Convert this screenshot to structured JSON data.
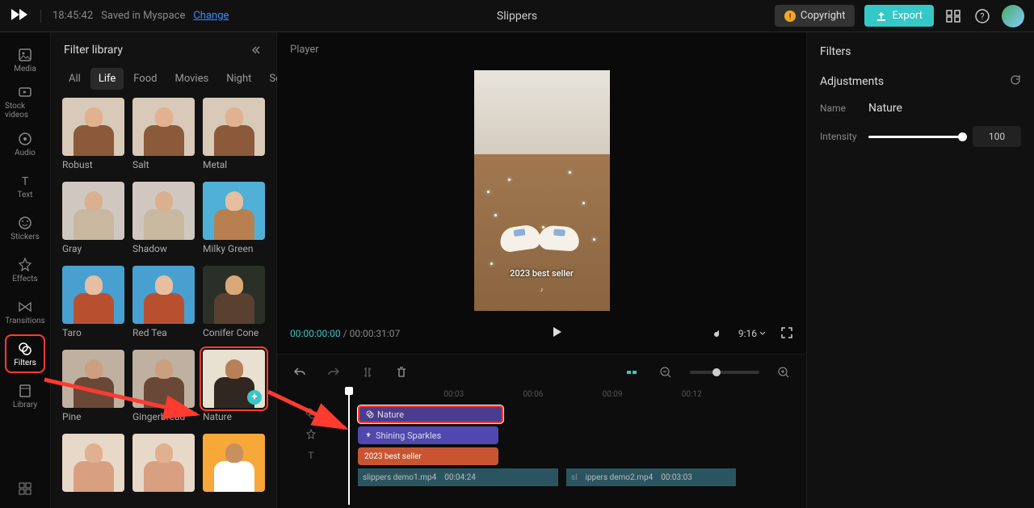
{
  "topbar": {
    "timestamp": "18:45:42",
    "saved_text": "Saved in Myspace",
    "change_link": "Change",
    "project_title": "Slippers",
    "copyright_label": "Copyright",
    "export_label": "Export"
  },
  "sidebar": {
    "items": [
      {
        "label": "Media"
      },
      {
        "label": "Stock videos"
      },
      {
        "label": "Audio"
      },
      {
        "label": "Text"
      },
      {
        "label": "Stickers"
      },
      {
        "label": "Effects"
      },
      {
        "label": "Transitions"
      },
      {
        "label": "Filters"
      },
      {
        "label": "Library"
      }
    ]
  },
  "library": {
    "title": "Filter library",
    "tabs": [
      "All",
      "Life",
      "Food",
      "Movies",
      "Night",
      "Sc"
    ],
    "active_tab": "Life",
    "filters": [
      {
        "label": "Robust",
        "bg": "#d8c9b8",
        "head": "#e2b18f",
        "body": "#8a5a3a"
      },
      {
        "label": "Salt",
        "bg": "#d8c9b8",
        "head": "#e2b18f",
        "body": "#8a5a3a"
      },
      {
        "label": "Metal",
        "bg": "#d8c9b8",
        "head": "#e2b18f",
        "body": "#8a5a3a"
      },
      {
        "label": "Gray",
        "bg": "#d0c8c0",
        "head": "#dab090",
        "body": "#c8b8a0"
      },
      {
        "label": "Shadow",
        "bg": "#d0c8c0",
        "head": "#dab090",
        "body": "#c8b8a0"
      },
      {
        "label": "Milky Green",
        "bg": "#50b0d8",
        "head": "#e6bfa0",
        "body": "#b88050"
      },
      {
        "label": "Taro",
        "bg": "#48a0d0",
        "head": "#e6bfa0",
        "body": "#b85030"
      },
      {
        "label": "Red Tea",
        "bg": "#48a0d0",
        "head": "#e6bfa0",
        "body": "#b85030"
      },
      {
        "label": "Conifer Cone",
        "bg": "#2a3028",
        "head": "#d8a878",
        "body": "#5a4030"
      },
      {
        "label": "Pine",
        "bg": "#c0b0a0",
        "head": "#caa080",
        "body": "#6a4838"
      },
      {
        "label": "Gingerbread",
        "bg": "#c0b0a0",
        "head": "#caa080",
        "body": "#6a4838"
      },
      {
        "label": "Nature",
        "bg": "#e8e0d0",
        "head": "#b88058",
        "body": "#302820"
      },
      {
        "label": "",
        "bg": "#e8d8c8",
        "head": "#e0b090",
        "body": "#d8a080"
      },
      {
        "label": "",
        "bg": "#e8d8c8",
        "head": "#e0b090",
        "body": "#d8a080"
      },
      {
        "label": "",
        "bg": "#f7a838",
        "head": "#c89060",
        "body": "#ffffff"
      }
    ],
    "selected_index": 11
  },
  "player": {
    "label": "Player",
    "current_tc": "00:00:00:00",
    "total_tc": "00:00:31:07",
    "ratio": "9:16",
    "preview_caption": "2023 best seller"
  },
  "timeline": {
    "marks": [
      "00:03",
      "00:06",
      "00:09",
      "00:12"
    ],
    "nature_clip": "Nature",
    "shining_clip": "Shining Sparkles",
    "best_clip": "2023 best seller",
    "video1_name": "slippers demo1.mp4",
    "video1_dur": "00:04:24",
    "video2_name": "ippers demo2.mp4",
    "video2_dur": "00:03:03"
  },
  "right_panel": {
    "title": "Filters",
    "section": "Adjustments",
    "name_label": "Name",
    "name_value": "Nature",
    "intensity_label": "Intensity",
    "intensity_value": "100"
  }
}
